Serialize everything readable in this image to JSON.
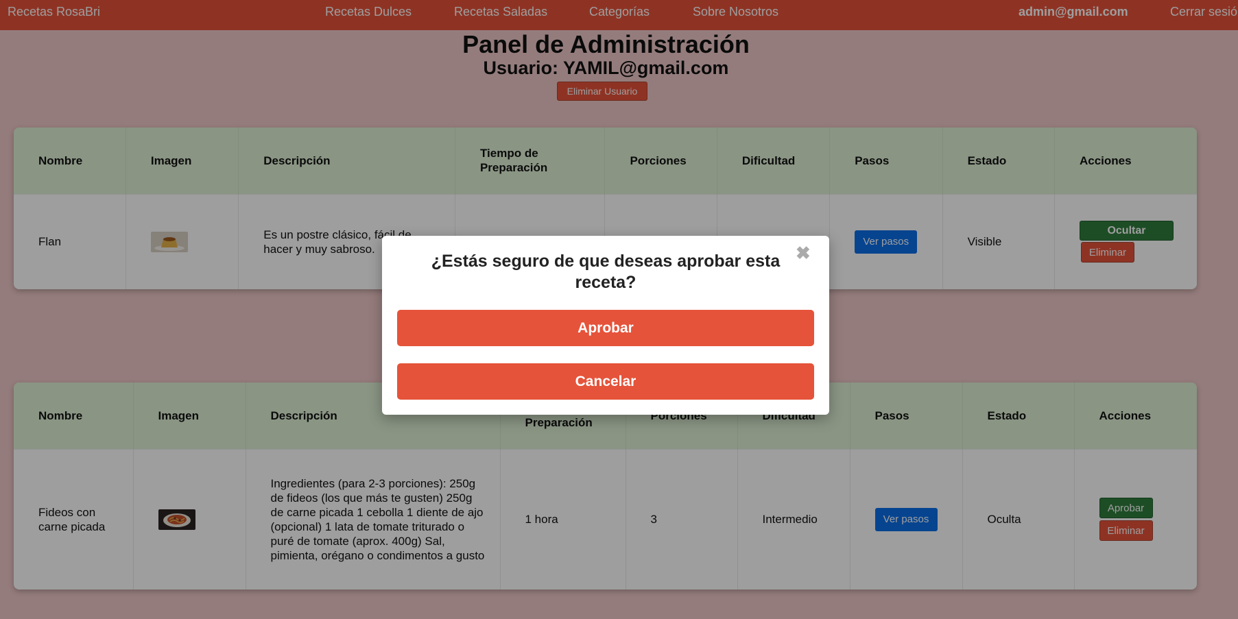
{
  "nav": {
    "brand": "Recetas RosaBri",
    "links": [
      "Recetas Dulces",
      "Recetas Saladas",
      "Categorías",
      "Sobre Nosotros"
    ],
    "user_email": "admin@gmail.com",
    "logout": "Cerrar sesión"
  },
  "header": {
    "title": "Panel de Administración",
    "user_label": "Usuario: YAMIL@gmail.com",
    "delete_user": "Eliminar Usuario"
  },
  "tables": [
    {
      "columns": [
        "Nombre",
        "Imagen",
        "Descripción",
        "Tiempo de Preparación",
        "Porciones",
        "Dificultad",
        "Pasos",
        "Estado",
        "Acciones"
      ],
      "row": {
        "name": "Flan",
        "image_icon": "flan-thumbnail",
        "description": "Es un postre clásico, fácil de hacer y muy sabroso.",
        "time": "",
        "portions": "",
        "difficulty": "",
        "steps_button": "Ver pasos",
        "status": "Visible",
        "action_primary": "Ocultar",
        "action_delete": "Eliminar"
      }
    },
    {
      "columns": [
        "Nombre",
        "Imagen",
        "Descripción",
        "Preparación",
        "Porciones",
        "Dificultad",
        "Pasos",
        "Estado",
        "Acciones"
      ],
      "row": {
        "name": "Fideos con carne picada",
        "image_icon": "pasta-thumbnail",
        "description": "Ingredientes (para 2-3 porciones): 250g de fideos (los que más te gusten) 250g de carne picada 1 cebolla 1 diente de ajo (opcional) 1 lata de tomate triturado o puré de tomate (aprox. 400g) Sal, pimienta, orégano o condimentos a gusto",
        "time": "1 hora",
        "portions": "3",
        "difficulty": "Intermedio",
        "steps_button": "Ver pasos",
        "status": "Oculta",
        "action_primary": "Aprobar",
        "action_delete": "Eliminar"
      }
    }
  ],
  "modal": {
    "question": "¿Estás seguro de que deseas aprobar esta receta?",
    "close_glyph": "✖",
    "confirm": "Aprobar",
    "cancel": "Cancelar"
  },
  "colors": {
    "accent": "#e5533a",
    "header_bg": "#dff1d6",
    "primary_blue": "#0b6fe8",
    "success_green": "#2f7d3d",
    "page_bg": "#f0c8c8"
  }
}
